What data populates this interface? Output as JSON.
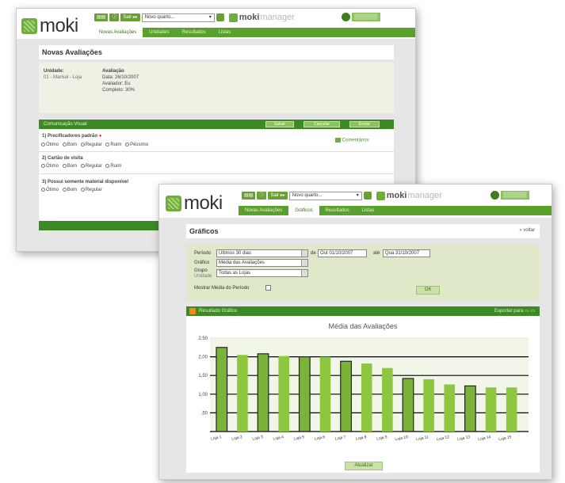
{
  "back_window": {
    "logo_text": "moki",
    "toolbar": {
      "btn_home": "▤▤",
      "btn_search": "ⓘ",
      "btn_user": "Sair ▸▸",
      "select_value": "Novo quarto...",
      "brand_a": "moki",
      "brand_b": "manager"
    },
    "corner_text": "▒▒▒▒▒▒",
    "nav": [
      "Novas Avaliações",
      "Unidades",
      "Resultados",
      "Listas"
    ],
    "page_title": "Novas Avaliações",
    "info": {
      "unidade_label": "Unidade:",
      "unidade_value": "01 - Marisol - Loja",
      "avaliacao_label": "Avaliação",
      "data": "Data: 26/10/2007",
      "avaliador": "Avaliador: Eu",
      "completo": "Completo: 30%"
    },
    "section": {
      "title": "Comunicação Visual",
      "btn1": "Salvar",
      "btn2": "Cancelar",
      "btn3": "Enviar",
      "comment": "Comentários"
    },
    "questions": [
      {
        "label": "1) Precificadores padrão ",
        "mark": "●",
        "options": [
          "Ótimo",
          "Bom",
          "Regular",
          "Ruim",
          "Péssimo"
        ]
      },
      {
        "label": "2) Cartão de visita",
        "options": [
          "Ótimo",
          "Bom",
          "Regular",
          "Ruim"
        ]
      },
      {
        "label": "3) Possui somente material disponível",
        "options": [
          "Ótimo",
          "Bom",
          "Regular"
        ]
      }
    ]
  },
  "front_window": {
    "logo_text": "moki",
    "toolbar": {
      "btn_home": "▤▤",
      "btn_search": "ⓘ",
      "btn_user": "Sair ▸▸",
      "select_value": "Novo quarto...",
      "brand_a": "moki",
      "brand_b": "manager"
    },
    "corner_text": "▒▒▒▒▒▒",
    "nav": [
      "Novas Avaliações",
      "Gráficos",
      "Resultados",
      "Listas"
    ],
    "nav_active_index": 1,
    "page_title": "Gráficos",
    "page_link": "« voltar",
    "filters": {
      "f1_label": "Período",
      "f1_value": "Últimos 30 dias",
      "date_from_label": "de",
      "date_from": "Out 01/10/2007",
      "date_to_label": "até",
      "date_to": "Qua 31/10/2007",
      "f2_label": "Gráfico",
      "f2_value": "Média das Avaliações",
      "f3_label": "Grupo",
      "f3_sublabel": "Unidade",
      "f3_value": "Todas as Lojas",
      "check_label": "Mostrar Média do Período",
      "ok_button": "OK"
    },
    "chart_header": "Resultado Gráfico",
    "chart_header_right": "Exportar para ▭ ▭",
    "update_button": "Atualizar"
  },
  "chart_data": {
    "type": "bar",
    "title": "Média das Avaliações",
    "xlabel": "",
    "ylabel": "",
    "ylim": [
      0,
      2.5
    ],
    "yticks": [
      "2,50",
      "2,00",
      "1,50",
      "1,00",
      ",50"
    ],
    "categories": [
      "Loja 1",
      "Loja 2",
      "Loja 3",
      "Loja 4",
      "Loja 5",
      "Loja 6",
      "Loja 7",
      "Loja 8",
      "Loja 9",
      "Loja 10",
      "Loja 11",
      "Loja 12",
      "Loja 13",
      "Loja 14",
      "Loja 15"
    ],
    "values": [
      2.25,
      2.05,
      2.08,
      2.02,
      2.0,
      2.0,
      1.88,
      1.82,
      1.7,
      1.42,
      1.4,
      1.26,
      1.22,
      1.18,
      1.18
    ],
    "highlighted": [
      0,
      2,
      4,
      6,
      9,
      12
    ],
    "colors": {
      "normal": "#8dc63f",
      "highlight": "#7ab33a",
      "outline": "#222222",
      "grid": "#000000"
    }
  }
}
